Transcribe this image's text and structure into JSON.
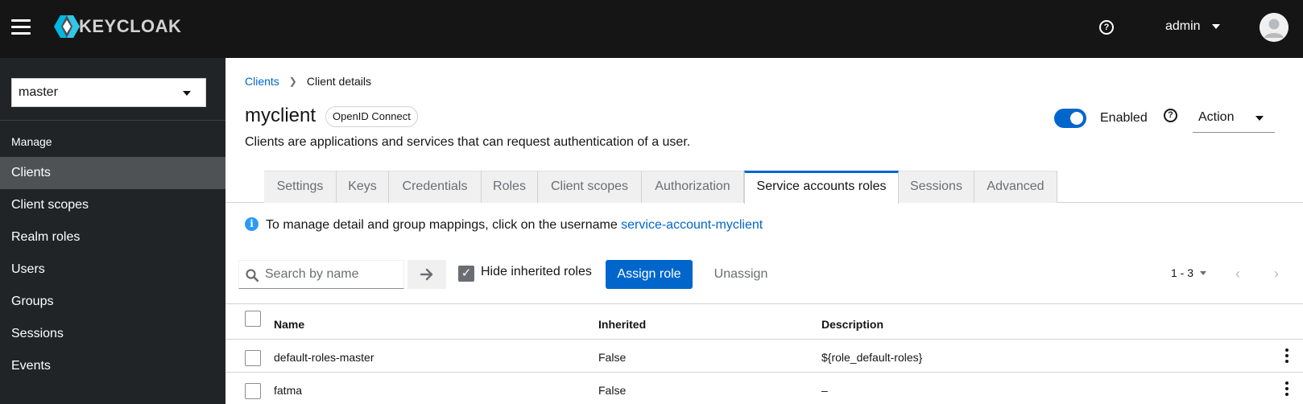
{
  "masthead": {
    "brand": "KEYCLOAK",
    "user": "admin"
  },
  "sidebar": {
    "realm": "master",
    "section": "Manage",
    "items": [
      {
        "label": "Clients",
        "active": true
      },
      {
        "label": "Client scopes"
      },
      {
        "label": "Realm roles"
      },
      {
        "label": "Users"
      },
      {
        "label": "Groups"
      },
      {
        "label": "Sessions"
      },
      {
        "label": "Events"
      }
    ]
  },
  "breadcrumb": {
    "parent": "Clients",
    "current": "Client details"
  },
  "header": {
    "title": "myclient",
    "protocol": "OpenID Connect",
    "description": "Clients are applications and services that can request authentication of a user.",
    "enabled_label": "Enabled",
    "enabled": true,
    "action_label": "Action"
  },
  "tabs": [
    {
      "label": "Settings"
    },
    {
      "label": "Keys"
    },
    {
      "label": "Credentials"
    },
    {
      "label": "Roles"
    },
    {
      "label": "Client scopes"
    },
    {
      "label": "Authorization"
    },
    {
      "label": "Service accounts roles",
      "active": true
    },
    {
      "label": "Sessions"
    },
    {
      "label": "Advanced"
    }
  ],
  "info": {
    "text": "To manage detail and group mappings, click on the username ",
    "link": "service-account-myclient"
  },
  "toolbar": {
    "search_placeholder": "Search by name",
    "hide_inherited_label": "Hide inherited roles",
    "hide_inherited_checked": true,
    "assign_label": "Assign role",
    "unassign_label": "Unassign",
    "pagination": "1 - 3"
  },
  "table": {
    "columns": [
      "Name",
      "Inherited",
      "Description"
    ],
    "rows": [
      {
        "name": "default-roles-master",
        "inherited": "False",
        "description": "${role_default-roles}"
      },
      {
        "name": "fatma",
        "inherited": "False",
        "description": "–"
      }
    ]
  },
  "colors": {
    "masthead": "#151515",
    "sidebar": "#212427",
    "accent": "#0066cc"
  }
}
